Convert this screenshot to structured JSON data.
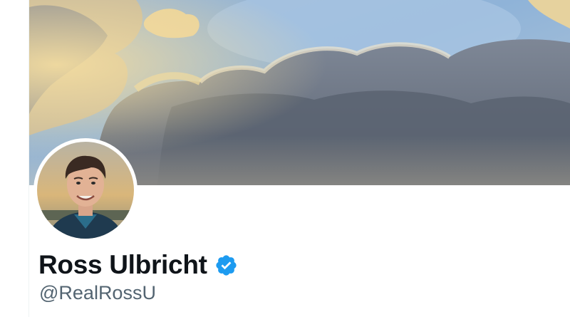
{
  "profile": {
    "display_name": "Ross Ulbricht",
    "handle": "@RealRossU",
    "verified": true
  },
  "images": {
    "banner": "sky-with-clouds-header-photo",
    "avatar": "profile-photo-smiling-man"
  },
  "icons": {
    "verified": "verified-badge-icon"
  },
  "colors": {
    "name_text": "#0f1419",
    "handle_text": "#536471",
    "verified_blue": "#1d9bf0",
    "background": "#ffffff",
    "divider": "#eff3f4"
  }
}
